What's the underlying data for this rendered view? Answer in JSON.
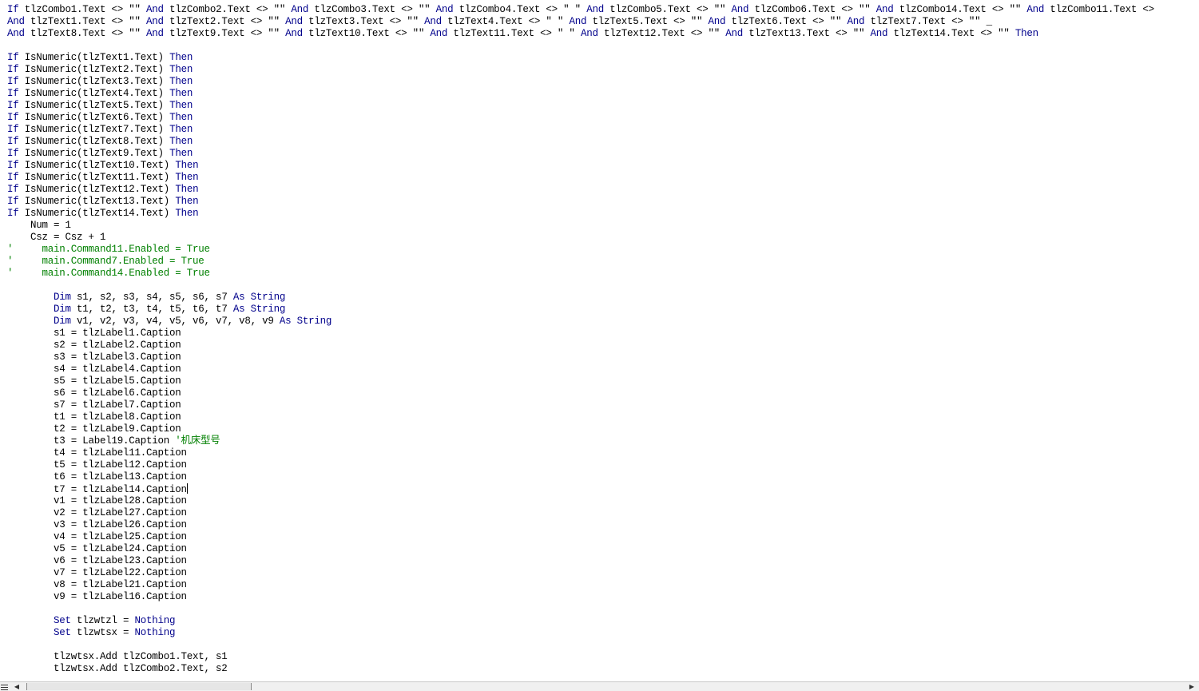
{
  "editor": {
    "language": "Visual Basic",
    "caret_line": 40,
    "colors": {
      "keyword": "#00008b",
      "comment": "#008000",
      "text": "#000000"
    },
    "lines": [
      [
        [
          "k",
          "If"
        ],
        [
          "t",
          " tlzCombo1.Text <> \"\" "
        ],
        [
          "k",
          "And"
        ],
        [
          "t",
          " tlzCombo2.Text <> \"\" "
        ],
        [
          "k",
          "And"
        ],
        [
          "t",
          " tlzCombo3.Text <> \"\" "
        ],
        [
          "k",
          "And"
        ],
        [
          "t",
          " tlzCombo4.Text <> \" \" "
        ],
        [
          "k",
          "And"
        ],
        [
          "t",
          " tlzCombo5.Text <> \"\" "
        ],
        [
          "k",
          "And"
        ],
        [
          "t",
          " tlzCombo6.Text <> \"\" "
        ],
        [
          "k",
          "And"
        ],
        [
          "t",
          " tlzCombo14.Text <> \"\" "
        ],
        [
          "k",
          "And"
        ],
        [
          "t",
          " tlzCombo11.Text <>"
        ]
      ],
      [
        [
          "k",
          "And"
        ],
        [
          "t",
          " tlzText1.Text <> \"\" "
        ],
        [
          "k",
          "And"
        ],
        [
          "t",
          " tlzText2.Text <> \"\" "
        ],
        [
          "k",
          "And"
        ],
        [
          "t",
          " tlzText3.Text <> \"\" "
        ],
        [
          "k",
          "And"
        ],
        [
          "t",
          " tlzText4.Text <> \" \" "
        ],
        [
          "k",
          "And"
        ],
        [
          "t",
          " tlzText5.Text <> \"\" "
        ],
        [
          "k",
          "And"
        ],
        [
          "t",
          " tlzText6.Text <> \"\" "
        ],
        [
          "k",
          "And"
        ],
        [
          "t",
          " tlzText7.Text <> \"\" _"
        ]
      ],
      [
        [
          "k",
          "And"
        ],
        [
          "t",
          " tlzText8.Text <> \"\" "
        ],
        [
          "k",
          "And"
        ],
        [
          "t",
          " tlzText9.Text <> \"\" "
        ],
        [
          "k",
          "And"
        ],
        [
          "t",
          " tlzText10.Text <> \"\" "
        ],
        [
          "k",
          "And"
        ],
        [
          "t",
          " tlzText11.Text <> \" \" "
        ],
        [
          "k",
          "And"
        ],
        [
          "t",
          " tlzText12.Text <> \"\" "
        ],
        [
          "k",
          "And"
        ],
        [
          "t",
          " tlzText13.Text <> \"\" "
        ],
        [
          "k",
          "And"
        ],
        [
          "t",
          " tlzText14.Text <> \"\" "
        ],
        [
          "k",
          "Then"
        ]
      ],
      [],
      [
        [
          "k",
          "If"
        ],
        [
          "t",
          " IsNumeric(tlzText1.Text) "
        ],
        [
          "k",
          "Then"
        ]
      ],
      [
        [
          "k",
          "If"
        ],
        [
          "t",
          " IsNumeric(tlzText2.Text) "
        ],
        [
          "k",
          "Then"
        ]
      ],
      [
        [
          "k",
          "If"
        ],
        [
          "t",
          " IsNumeric(tlzText3.Text) "
        ],
        [
          "k",
          "Then"
        ]
      ],
      [
        [
          "k",
          "If"
        ],
        [
          "t",
          " IsNumeric(tlzText4.Text) "
        ],
        [
          "k",
          "Then"
        ]
      ],
      [
        [
          "k",
          "If"
        ],
        [
          "t",
          " IsNumeric(tlzText5.Text) "
        ],
        [
          "k",
          "Then"
        ]
      ],
      [
        [
          "k",
          "If"
        ],
        [
          "t",
          " IsNumeric(tlzText6.Text) "
        ],
        [
          "k",
          "Then"
        ]
      ],
      [
        [
          "k",
          "If"
        ],
        [
          "t",
          " IsNumeric(tlzText7.Text) "
        ],
        [
          "k",
          "Then"
        ]
      ],
      [
        [
          "k",
          "If"
        ],
        [
          "t",
          " IsNumeric(tlzText8.Text) "
        ],
        [
          "k",
          "Then"
        ]
      ],
      [
        [
          "k",
          "If"
        ],
        [
          "t",
          " IsNumeric(tlzText9.Text) "
        ],
        [
          "k",
          "Then"
        ]
      ],
      [
        [
          "k",
          "If"
        ],
        [
          "t",
          " IsNumeric(tlzText10.Text) "
        ],
        [
          "k",
          "Then"
        ]
      ],
      [
        [
          "k",
          "If"
        ],
        [
          "t",
          " IsNumeric(tlzText11.Text) "
        ],
        [
          "k",
          "Then"
        ]
      ],
      [
        [
          "k",
          "If"
        ],
        [
          "t",
          " IsNumeric(tlzText12.Text) "
        ],
        [
          "k",
          "Then"
        ]
      ],
      [
        [
          "k",
          "If"
        ],
        [
          "t",
          " IsNumeric(tlzText13.Text) "
        ],
        [
          "k",
          "Then"
        ]
      ],
      [
        [
          "k",
          "If"
        ],
        [
          "t",
          " IsNumeric(tlzText14.Text) "
        ],
        [
          "k",
          "Then"
        ]
      ],
      [
        [
          "t",
          "    Num = 1"
        ]
      ],
      [
        [
          "t",
          "    Csz = Csz + 1"
        ]
      ],
      [
        [
          "c",
          "'     main.Command11.Enabled = True"
        ]
      ],
      [
        [
          "c",
          "'     main.Command7.Enabled = True"
        ]
      ],
      [
        [
          "c",
          "'     main.Command14.Enabled = True"
        ]
      ],
      [],
      [
        [
          "t",
          "        "
        ],
        [
          "k",
          "Dim"
        ],
        [
          "t",
          " s1, s2, s3, s4, s5, s6, s7 "
        ],
        [
          "k",
          "As String"
        ]
      ],
      [
        [
          "t",
          "        "
        ],
        [
          "k",
          "Dim"
        ],
        [
          "t",
          " t1, t2, t3, t4, t5, t6, t7 "
        ],
        [
          "k",
          "As String"
        ]
      ],
      [
        [
          "t",
          "        "
        ],
        [
          "k",
          "Dim"
        ],
        [
          "t",
          " v1, v2, v3, v4, v5, v6, v7, v8, v9 "
        ],
        [
          "k",
          "As String"
        ]
      ],
      [
        [
          "t",
          "        s1 = tlzLabel1.Caption"
        ]
      ],
      [
        [
          "t",
          "        s2 = tlzLabel2.Caption"
        ]
      ],
      [
        [
          "t",
          "        s3 = tlzLabel3.Caption"
        ]
      ],
      [
        [
          "t",
          "        s4 = tlzLabel4.Caption"
        ]
      ],
      [
        [
          "t",
          "        s5 = tlzLabel5.Caption"
        ]
      ],
      [
        [
          "t",
          "        s6 = tlzLabel6.Caption"
        ]
      ],
      [
        [
          "t",
          "        s7 = tlzLabel7.Caption"
        ]
      ],
      [
        [
          "t",
          "        t1 = tlzLabel8.Caption"
        ]
      ],
      [
        [
          "t",
          "        t2 = tlzLabel9.Caption"
        ]
      ],
      [
        [
          "t",
          "        t3 = Label19.Caption "
        ],
        [
          "c",
          "'机床型号"
        ]
      ],
      [
        [
          "t",
          "        t4 = tlzLabel11.Caption"
        ]
      ],
      [
        [
          "t",
          "        t5 = tlzLabel12.Caption"
        ]
      ],
      [
        [
          "t",
          "        t6 = tlzLabel13.Caption"
        ]
      ],
      [
        [
          "t",
          "        t7 = tlzLabel14.Caption"
        ]
      ],
      [
        [
          "t",
          "        v1 = tlzLabel28.Caption"
        ]
      ],
      [
        [
          "t",
          "        v2 = tlzLabel27.Caption"
        ]
      ],
      [
        [
          "t",
          "        v3 = tlzLabel26.Caption"
        ]
      ],
      [
        [
          "t",
          "        v4 = tlzLabel25.Caption"
        ]
      ],
      [
        [
          "t",
          "        v5 = tlzLabel24.Caption"
        ]
      ],
      [
        [
          "t",
          "        v6 = tlzLabel23.Caption"
        ]
      ],
      [
        [
          "t",
          "        v7 = tlzLabel22.Caption"
        ]
      ],
      [
        [
          "t",
          "        v8 = tlzLabel21.Caption"
        ]
      ],
      [
        [
          "t",
          "        v9 = tlzLabel16.Caption"
        ]
      ],
      [],
      [
        [
          "t",
          "        "
        ],
        [
          "k",
          "Set"
        ],
        [
          "t",
          " tlzwtzl = "
        ],
        [
          "k",
          "Nothing"
        ]
      ],
      [
        [
          "t",
          "        "
        ],
        [
          "k",
          "Set"
        ],
        [
          "t",
          " tlzwtsx = "
        ],
        [
          "k",
          "Nothing"
        ]
      ],
      [],
      [
        [
          "t",
          "        tlzwtsx.Add tlzCombo1.Text, s1"
        ]
      ],
      [
        [
          "t",
          "        tlzwtsx.Add tlzCombo2.Text, s2"
        ]
      ]
    ]
  },
  "statusbar": {
    "view_icon": "full-module-view-icon",
    "left_arrow": "◀",
    "right_arrow": "▶"
  }
}
